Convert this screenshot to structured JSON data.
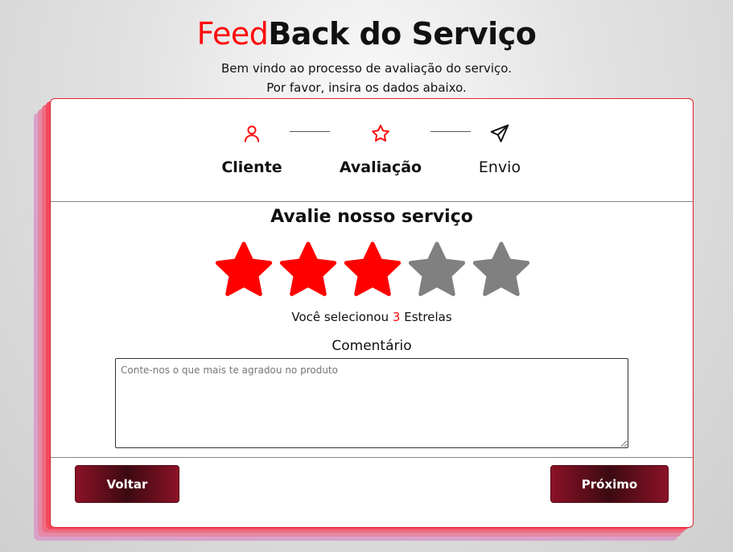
{
  "header": {
    "title_accent": "Feed",
    "title_rest": "Back do Serviço",
    "subtitle_line1": "Bem vindo ao processo de avaliação do serviço.",
    "subtitle_line2": "Por favor, insira os dados abaixo."
  },
  "colors": {
    "accent": "#ff0a0a",
    "star_filled": "#ff0000",
    "star_empty": "#808080",
    "button": "#8b1226"
  },
  "steps": [
    {
      "label": "Cliente",
      "icon": "user-icon",
      "active": true
    },
    {
      "label": "Avaliação",
      "icon": "star-outline-icon",
      "active": true
    },
    {
      "label": "Envio",
      "icon": "send-icon",
      "active": false
    }
  ],
  "rating": {
    "title": "Avalie nosso serviço",
    "selected": 3,
    "max": 5,
    "summary_prefix": "Você selecionou",
    "summary_count": "3",
    "summary_suffix": "Estrelas"
  },
  "comment": {
    "label": "Comentário",
    "placeholder": "Conte-nos o que mais te agradou no produto",
    "value": ""
  },
  "buttons": {
    "back_label": "Voltar",
    "next_label": "Próximo"
  }
}
